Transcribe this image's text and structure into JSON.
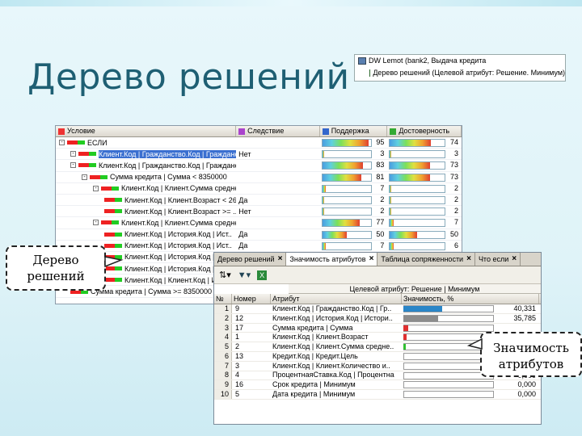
{
  "slide": {
    "title": "Дерево решений"
  },
  "mini_panel": {
    "row1": "DW Lemot (bank2, Выдача кредита",
    "row2": "Дерево решений (Целевой атрибут: Решение. Минимум)"
  },
  "tree": {
    "headers": [
      "Условие",
      "Следствие",
      "Поддержка",
      "Достоверность"
    ],
    "rows": [
      {
        "level": 0,
        "exp": "-",
        "label": "ЕСЛИ",
        "outcome": "",
        "support": 95,
        "conf": 74,
        "selected": false
      },
      {
        "level": 1,
        "exp": "-",
        "label": "Клиент.Код | Гражданство.Код | Граждане..",
        "outcome": "Нет",
        "support": 3,
        "conf": 3,
        "selected": true
      },
      {
        "level": 1,
        "exp": "-",
        "label": "Клиент.Код | Гражданство.Код | Граждане..",
        "outcome": "",
        "support": 83,
        "conf": 73,
        "selected": false
      },
      {
        "level": 2,
        "exp": "-",
        "label": "Сумма кредита | Сумма < 8350000",
        "outcome": "",
        "support": 81,
        "conf": 73,
        "selected": false
      },
      {
        "level": 3,
        "exp": "-",
        "label": "Клиент.Код | Клиент.Сумма средне..",
        "outcome": "",
        "support": 7,
        "conf": 2,
        "selected": false
      },
      {
        "level": 4,
        "exp": "",
        "label": "Клиент.Код | Клиент.Возраст < 26.",
        "outcome": "Да",
        "support": 2,
        "conf": 2,
        "selected": false
      },
      {
        "level": 4,
        "exp": "",
        "label": "Клиент.Код | Клиент.Возраст >= ..",
        "outcome": "Нет",
        "support": 2,
        "conf": 2,
        "selected": false
      },
      {
        "level": 3,
        "exp": "-",
        "label": "Клиент.Код | Клиент.Сумма средне..",
        "outcome": "",
        "support": 77,
        "conf": 7,
        "selected": false
      },
      {
        "level": 4,
        "exp": "",
        "label": "Клиент.Код | История.Код | Ист..",
        "outcome": "Да",
        "support": 50,
        "conf": 50,
        "selected": false
      },
      {
        "level": 4,
        "exp": "",
        "label": "Клиент.Код | История.Код | Ист..",
        "outcome": "Да",
        "support": 7,
        "conf": 6,
        "selected": false
      },
      {
        "level": 4,
        "exp": "",
        "label": "Клиент.Код | История.Код | Ист..",
        "outcome": "",
        "support": "",
        "conf": "",
        "selected": false
      },
      {
        "level": 4,
        "exp": "",
        "label": "Клиент.Код | История.Код | Ист..",
        "outcome": "",
        "support": "",
        "conf": "",
        "selected": false
      },
      {
        "level": 4,
        "exp": "",
        "label": "Клиент.Код | Клиент.Код | Ист..",
        "outcome": "",
        "support": "",
        "conf": "",
        "selected": false
      },
      {
        "level": 1,
        "exp": "",
        "label": "Сумма кредита | Сумма >= 8350000",
        "outcome": "",
        "support": "",
        "conf": "",
        "selected": false
      }
    ]
  },
  "importance": {
    "tabs": [
      {
        "label": "Дерево решений",
        "active": false
      },
      {
        "label": "Значимость атрибутов",
        "active": true
      },
      {
        "label": "Таблица сопряженности",
        "active": false
      },
      {
        "label": "Что если",
        "active": false
      }
    ],
    "target_label": "Целевой атрибут: Решение | Минимум",
    "headers": [
      "№",
      "Номер",
      "Атрибут",
      "Значимость, %"
    ],
    "rows": [
      {
        "no": "1",
        "num": "9",
        "attr": "Клиент.Код | Гражданство.Код | Гр..",
        "pct": 40.331,
        "val": "40,331",
        "color": "#2a86c8"
      },
      {
        "no": "2",
        "num": "12",
        "attr": "Клиент.Код | История.Код | Истори..",
        "pct": 35.785,
        "val": "35,785",
        "color": "#8c8c8c"
      },
      {
        "no": "3",
        "num": "17",
        "attr": "Сумма кредита | Сумма",
        "pct": 5.0,
        "val": "",
        "color": "#e03030"
      },
      {
        "no": "4",
        "num": "1",
        "attr": "Клиент.Код | Клиент.Возраст",
        "pct": 3.0,
        "val": "",
        "color": "#e03030"
      },
      {
        "no": "5",
        "num": "2",
        "attr": "Клиент.Код | Клиент.Сумма средне..",
        "pct": 2.5,
        "val": "",
        "color": "#30c030"
      },
      {
        "no": "6",
        "num": "13",
        "attr": "Кредит.Код | Кредит.Цель",
        "pct": 0,
        "val": "",
        "color": "#ccc"
      },
      {
        "no": "7",
        "num": "3",
        "attr": "Клиент.Код | Клиент.Количество и..",
        "pct": 0,
        "val": "0,000",
        "color": "#ccc"
      },
      {
        "no": "8",
        "num": "4",
        "attr": "ПроцентнаяСтавка.Код | Процентна",
        "pct": 0,
        "val": "0,000",
        "color": "#ccc"
      },
      {
        "no": "9",
        "num": "16",
        "attr": "Срок кредита | Минимум",
        "pct": 0,
        "val": "0,000",
        "color": "#ccc"
      },
      {
        "no": "10",
        "num": "5",
        "attr": "Дата кредита | Минимум",
        "pct": 0,
        "val": "0,000",
        "color": "#ccc"
      }
    ]
  },
  "callouts": {
    "tree_label": "Дерево решений",
    "importance_label": "Значимость атрибутов"
  }
}
